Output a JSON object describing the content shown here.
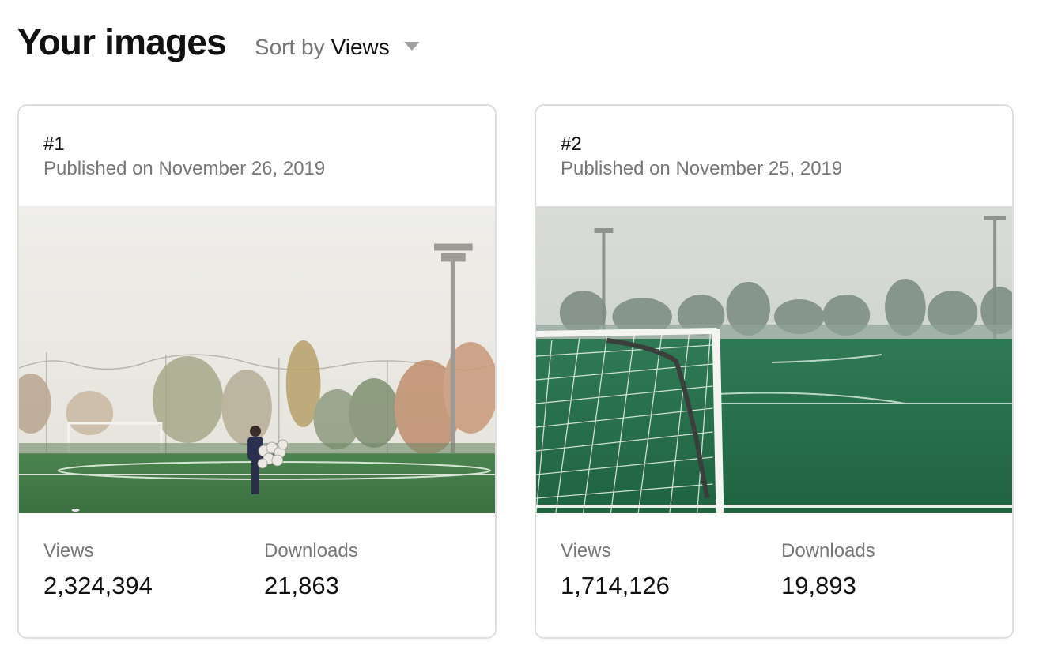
{
  "page": {
    "title": "Your images",
    "sort_prefix": "Sort by",
    "sort_value": "Views",
    "sort_icon": "chevron-down-icon"
  },
  "cards": [
    {
      "rank": "#1",
      "published": "Published on November 26, 2019",
      "views_label": "Views",
      "views": "2,324,394",
      "downloads_label": "Downloads",
      "downloads": "21,863"
    },
    {
      "rank": "#2",
      "published": "Published on November 25, 2019",
      "views_label": "Views",
      "views": "1,714,126",
      "downloads_label": "Downloads",
      "downloads": "19,893"
    }
  ],
  "colors": {
    "title": "#111111",
    "muted": "#767676",
    "card_border": "#dedede",
    "turf": "#3f7a45",
    "fog": "#e9e8e3"
  }
}
